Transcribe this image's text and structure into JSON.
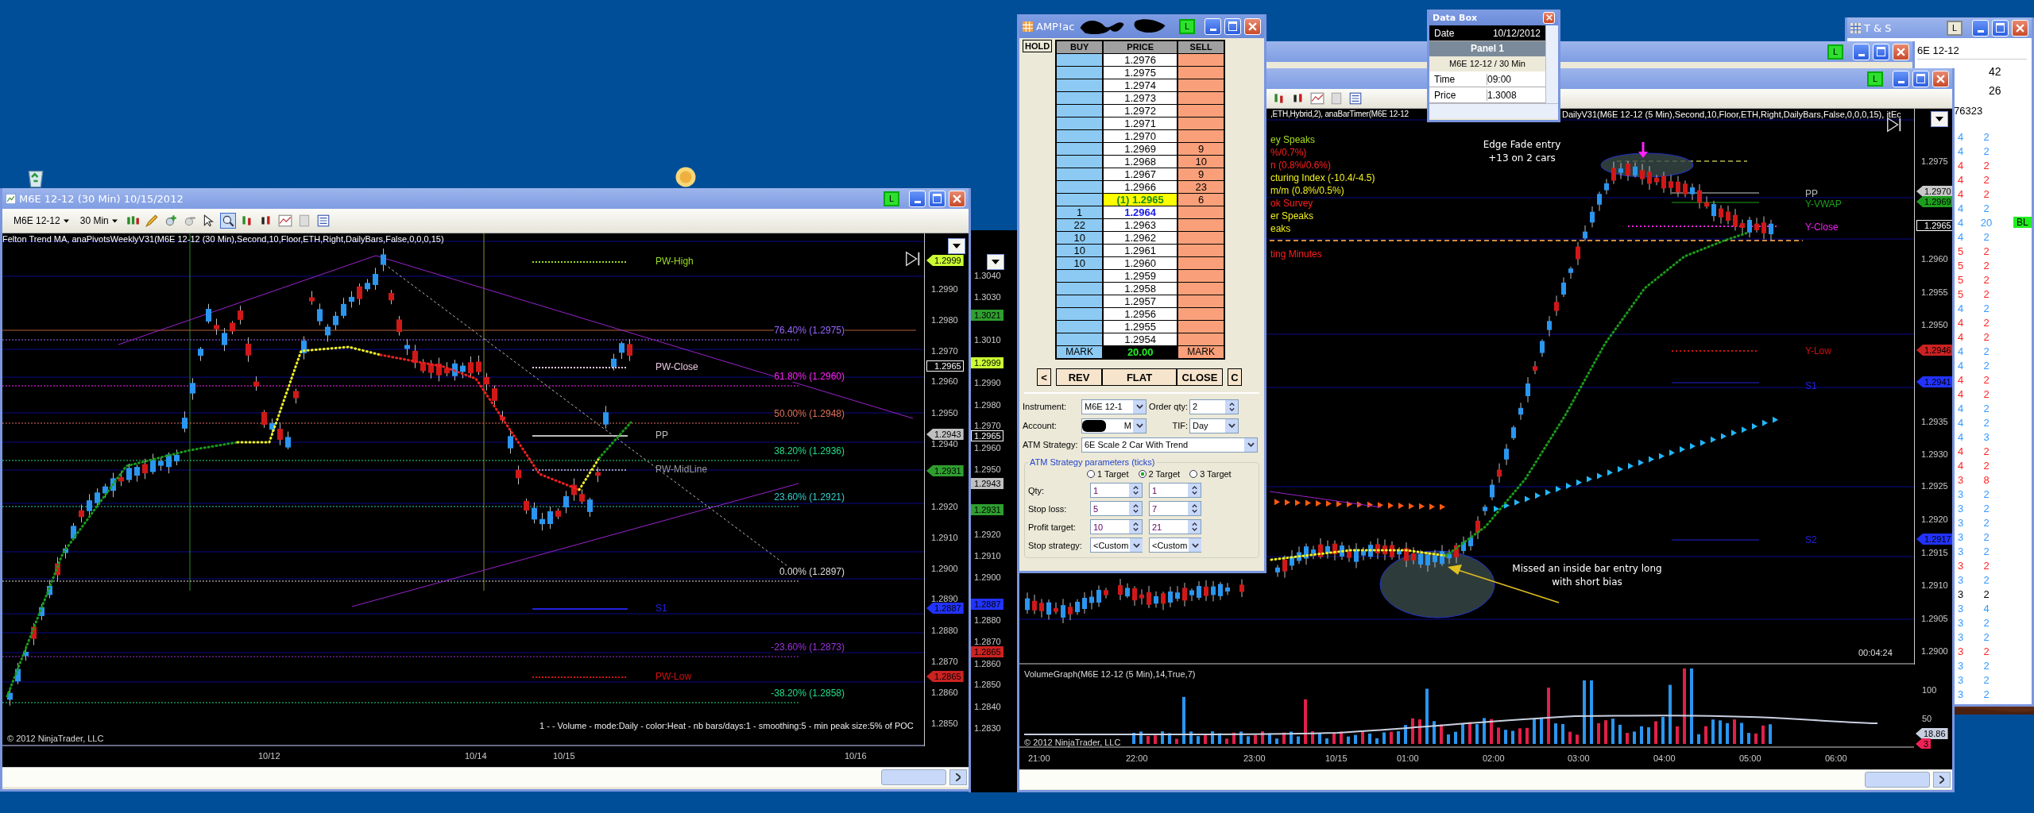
{
  "left_chart": {
    "title": "M6E 12-12 (30 Min)  10/15/2012",
    "online": "L",
    "instrument": "M6E 12-12",
    "interval": "30 Min",
    "indicators": "Felton Trend MA, anaPivotsWeeklyV31(M6E 12-12 (30 Min),Second,10,Floor,ETH,Right,DailyBars,False,0,0,0,15)",
    "price_labels": [
      "1.2990",
      "1.2980",
      "1.2970",
      "1.2960",
      "1.2950",
      "1.2940",
      "1.2920",
      "1.2910",
      "1.2900",
      "1.2890",
      "1.2880",
      "1.2870",
      "1.2860",
      "1.2850"
    ],
    "price_tags": [
      {
        "text": "1.2999",
        "color": "#ccff33"
      },
      {
        "text": "1.2965",
        "color": "#000000"
      },
      {
        "text": "1.2943",
        "color": "#c0c0c0"
      },
      {
        "text": "1.2931",
        "color": "#2f9e2f"
      },
      {
        "text": "1.2887",
        "color": "#2233ff"
      },
      {
        "text": "1.2865",
        "color": "#cc2222"
      }
    ],
    "levels": [
      {
        "label": "PW-High",
        "color": "#99dd22"
      },
      {
        "label": "PW-Close",
        "color": "#e8c8e0"
      },
      {
        "label": "PP",
        "color": "#bbbbbb"
      },
      {
        "label": "PW-MidLine",
        "color": "#9a9a9a"
      },
      {
        "label": "S1",
        "color": "#2222dd"
      },
      {
        "label": "PW-Low",
        "color": "#cc1111"
      }
    ],
    "fib_labels": [
      {
        "text": "76.40% (1.2975)",
        "color": "#9966ff"
      },
      {
        "text": "61.80% (1.2960)",
        "color": "#ff22ff"
      },
      {
        "text": "50.00% (1.2948)",
        "color": "#e0705a"
      },
      {
        "text": "38.20% (1.2936)",
        "color": "#22dd88"
      },
      {
        "text": "23.60% (1.2921)",
        "color": "#33cccc"
      },
      {
        "text": "0.00% (1.2897)",
        "color": "#dddddd"
      },
      {
        "text": "-23.60% (1.2873)",
        "color": "#9933dd"
      },
      {
        "text": "-38.20% (1.2858)",
        "color": "#22dd88"
      }
    ],
    "footer": "1 -   - Volume - mode:Daily  - color:Heat - nb bars/days:1 - smoothing:5 - min peak size:5% of POC",
    "copyright": "© 2012 NinjaTrader, LLC",
    "time_labels": [
      "10/12",
      "10/14",
      "10/15",
      "10/16"
    ]
  },
  "background_chart": {
    "price_labels": [
      "1.3040",
      "1.3030",
      "1.3010",
      "1.2990",
      "1.2980",
      "1.2970",
      "1.2960",
      "1.2950",
      "1.2920",
      "1.2910",
      "1.2900",
      "1.2880",
      "1.2870",
      "1.2860",
      "1.2850",
      "1.2840",
      "1.2830"
    ],
    "price_tags": [
      {
        "text": "1.3021",
        "color": "#2f9e2f"
      },
      {
        "text": "1.2999",
        "color": "#ccff33"
      },
      {
        "text": "1.2965",
        "color": "#000000"
      },
      {
        "text": "1.2943",
        "color": "#c0c0c0"
      },
      {
        "text": "1.2931",
        "color": "#2f9e2f"
      },
      {
        "text": "1.2887",
        "color": "#2233ff"
      },
      {
        "text": "1.2865",
        "color": "#cc2222"
      }
    ]
  },
  "dom": {
    "title": "AMP!ac",
    "online": "L",
    "hold": "HOLD",
    "headers": [
      "BUY",
      "PRICE",
      "SELL"
    ],
    "rows": [
      {
        "buy": "",
        "price": "1.2976",
        "sell": "",
        "kind": "normal"
      },
      {
        "buy": "",
        "price": "1.2975",
        "sell": "",
        "kind": "normal"
      },
      {
        "buy": "",
        "price": "1.2974",
        "sell": "",
        "kind": "normal"
      },
      {
        "buy": "",
        "price": "1.2973",
        "sell": "",
        "kind": "normal"
      },
      {
        "buy": "",
        "price": "1.2972",
        "sell": "",
        "kind": "normal"
      },
      {
        "buy": "",
        "price": "1.2971",
        "sell": "",
        "kind": "normal"
      },
      {
        "buy": "",
        "price": "1.2970",
        "sell": "",
        "kind": "normal"
      },
      {
        "buy": "",
        "price": "1.2969",
        "sell": "9",
        "kind": "normal"
      },
      {
        "buy": "",
        "price": "1.2968",
        "sell": "10",
        "kind": "normal"
      },
      {
        "buy": "",
        "price": "1.2967",
        "sell": "9",
        "kind": "normal"
      },
      {
        "buy": "",
        "price": "1.2966",
        "sell": "23",
        "kind": "normal"
      },
      {
        "buy": "",
        "price": "(1)  1.2965",
        "sell": "6",
        "kind": "last"
      },
      {
        "buy": "1",
        "price": "1.2964",
        "sell": "",
        "kind": "bid"
      },
      {
        "buy": "22",
        "price": "1.2963",
        "sell": "",
        "kind": "normal"
      },
      {
        "buy": "10",
        "price": "1.2962",
        "sell": "",
        "kind": "normal"
      },
      {
        "buy": "10",
        "price": "1.2961",
        "sell": "",
        "kind": "normal"
      },
      {
        "buy": "10",
        "price": "1.2960",
        "sell": "",
        "kind": "normal"
      },
      {
        "buy": "",
        "price": "1.2959",
        "sell": "",
        "kind": "normal"
      },
      {
        "buy": "",
        "price": "1.2958",
        "sell": "",
        "kind": "normal"
      },
      {
        "buy": "",
        "price": "1.2957",
        "sell": "",
        "kind": "normal"
      },
      {
        "buy": "",
        "price": "1.2956",
        "sell": "",
        "kind": "normal"
      },
      {
        "buy": "",
        "price": "1.2955",
        "sell": "",
        "kind": "normal"
      },
      {
        "buy": "",
        "price": "1.2954",
        "sell": "",
        "kind": "normal"
      }
    ],
    "footer": [
      "MARK",
      "20.00",
      "MARK"
    ],
    "buttons": [
      "<",
      "REV",
      "FLAT",
      "CLOSE",
      "C"
    ],
    "form": {
      "instrument_label": "Instrument:",
      "instrument": "M6E 12-1",
      "order_qty_label": "Order qty:",
      "order_qty": "2",
      "account_label": "Account:",
      "account": "M",
      "tif_label": "TIF:",
      "tif": "Day",
      "atm_label": "ATM Strategy:",
      "atm": "6E Scale 2 Car With Trend",
      "group_title": "ATM Strategy parameters (ticks)",
      "targets": [
        {
          "label": "1 Target",
          "selected": false
        },
        {
          "label": "2 Target",
          "selected": true
        },
        {
          "label": "3 Target",
          "selected": false
        }
      ],
      "params": [
        {
          "label": "Qty:",
          "kind": "spin",
          "values": [
            "1",
            "1"
          ]
        },
        {
          "label": "Stop loss:",
          "kind": "spin",
          "values": [
            "5",
            "7"
          ]
        },
        {
          "label": "Profit target:",
          "kind": "spin",
          "values": [
            "10",
            "21"
          ]
        },
        {
          "label": "Stop strategy:",
          "kind": "combo",
          "values": [
            "<Custom",
            "<Custom"
          ]
        }
      ]
    }
  },
  "data_box": {
    "title": "Data Box",
    "rows": [
      {
        "label": "Date",
        "value": "10/12/2012",
        "kind": "header"
      },
      {
        "label": "Panel 1",
        "kind": "panel"
      },
      {
        "label": "M6E 12-12 / 30 Min",
        "kind": "series"
      },
      {
        "label": "Time",
        "value": "09:00",
        "kind": "field"
      },
      {
        "label": "Price",
        "value": "1.3008",
        "kind": "field"
      }
    ]
  },
  "right_chart": {
    "online": "L",
    "back_online": "L",
    "indicators": [
      ",ETH,Hybrid,2), anaBarTimer(M6E 12-12",
      "DailyV31(M6E 12-12 (5 Min),Second,10,Floor,ETH,Right,DailyBars,False,0,0,0,15), itEc"
    ],
    "news": [
      {
        "text": "ey Speaks",
        "color": "#aadd22"
      },
      {
        "text": "%/0.7%)",
        "color": "#ff2020"
      },
      {
        "text": "n (0.8%/0.6%)",
        "color": "#ff2020"
      },
      {
        "text": "cturing Index (-10.4/-4.5)",
        "color": "#f0f020"
      },
      {
        "text": "m/m (0.8%/0.5%)",
        "color": "#f0f020"
      },
      {
        "text": "ok Survey",
        "color": "#ff2020"
      },
      {
        "text": "er Speaks",
        "color": "#f0f020"
      },
      {
        "text": "eaks",
        "color": "#f0f020"
      },
      {
        "text": "ting Minutes",
        "color": "#ff2020"
      }
    ],
    "annotations": [
      {
        "lines": [
          "Edge Fade entry",
          "+13 on 2 cars"
        ]
      },
      {
        "lines": [
          "Missed an inside bar entry long",
          "with short bias"
        ]
      }
    ],
    "price_labels": [
      "1.2975",
      "1.2960",
      "1.2955",
      "1.2950",
      "1.2935",
      "1.2930",
      "1.2925",
      "1.2920",
      "1.2915",
      "1.2910",
      "1.2905",
      "1.2900"
    ],
    "price_tags": [
      {
        "text": "1.2970",
        "color": "#c8c8c8"
      },
      {
        "text": "1.2969",
        "color": "#1e9e1e"
      },
      {
        "text": "1.2965",
        "color": "#000000"
      },
      {
        "text": "1.2946",
        "color": "#cc2222"
      },
      {
        "text": "1.2941",
        "color": "#2233ff"
      },
      {
        "text": "1.2917",
        "color": "#2233ff"
      }
    ],
    "levels": [
      {
        "label": "PP",
        "color": "#bbbbbb"
      },
      {
        "label": "Y-VWAP",
        "color": "#1e9e1e"
      },
      {
        "label": "Y-Close",
        "color": "#ee22ee"
      },
      {
        "label": "Y-Low",
        "color": "#cc1111"
      },
      {
        "label": "S1",
        "color": "#2222dd"
      },
      {
        "label": "S2",
        "color": "#2222dd"
      }
    ],
    "timer": "00:04:24",
    "volume_title": "VolumeGraph(M6E 12-12 (5 Min),14,True,7)",
    "volume_labels": [
      "100",
      "50"
    ],
    "volume_tags": [
      {
        "text": "18.86",
        "color": "#c8d0e0"
      },
      {
        "text": "3",
        "color": "#ee2255"
      }
    ],
    "copyright": "© 2012 NinjaTrader, LLC",
    "time_labels": [
      "21:00",
      "22:00",
      "23:00",
      "10/15",
      "01:00",
      "02:00",
      "03:00",
      "04:00",
      "05:00",
      "06:00"
    ]
  },
  "time_sales": {
    "title": "T & S",
    "online": "L",
    "instrument": "6E 12-12",
    "summary": [
      "42",
      "26",
      "76323"
    ],
    "trades": [
      {
        "price": "4",
        "size": "2",
        "color": "#3399ff"
      },
      {
        "price": "4",
        "size": "2",
        "color": "#3399ff"
      },
      {
        "price": "4",
        "size": "2",
        "color": "#ff2222"
      },
      {
        "price": "4",
        "size": "2",
        "color": "#ff2222"
      },
      {
        "price": "4",
        "size": "2",
        "color": "#ff2222"
      },
      {
        "price": "4",
        "size": "2",
        "color": "#3399ff"
      },
      {
        "price": "4",
        "size": "20",
        "color": "#3399ff",
        "badge": "BL"
      },
      {
        "price": "4",
        "size": "2",
        "color": "#3399ff"
      },
      {
        "price": "5",
        "size": "2",
        "color": "#ff2222"
      },
      {
        "price": "5",
        "size": "2",
        "color": "#ff2222"
      },
      {
        "price": "5",
        "size": "2",
        "color": "#ff2222"
      },
      {
        "price": "5",
        "size": "2",
        "color": "#ff2222"
      },
      {
        "price": "4",
        "size": "2",
        "color": "#3399ff"
      },
      {
        "price": "4",
        "size": "2",
        "color": "#ff2222"
      },
      {
        "price": "4",
        "size": "2",
        "color": "#ff2222"
      },
      {
        "price": "4",
        "size": "2",
        "color": "#3399ff"
      },
      {
        "price": "4",
        "size": "2",
        "color": "#3399ff"
      },
      {
        "price": "4",
        "size": "2",
        "color": "#ff2222"
      },
      {
        "price": "4",
        "size": "2",
        "color": "#ff2222"
      },
      {
        "price": "4",
        "size": "2",
        "color": "#3399ff"
      },
      {
        "price": "4",
        "size": "2",
        "color": "#3399ff"
      },
      {
        "price": "4",
        "size": "3",
        "color": "#3399ff"
      },
      {
        "price": "4",
        "size": "2",
        "color": "#ff2222"
      },
      {
        "price": "4",
        "size": "2",
        "color": "#ff2222"
      },
      {
        "price": "3",
        "size": "8",
        "color": "#ff2222"
      },
      {
        "price": "3",
        "size": "2",
        "color": "#3399ff"
      },
      {
        "price": "3",
        "size": "2",
        "color": "#3399ff"
      },
      {
        "price": "3",
        "size": "2",
        "color": "#3399ff"
      },
      {
        "price": "3",
        "size": "2",
        "color": "#3399ff"
      },
      {
        "price": "3",
        "size": "2",
        "color": "#3399ff"
      },
      {
        "price": "3",
        "size": "2",
        "color": "#ff2222"
      },
      {
        "price": "3",
        "size": "2",
        "color": "#3399ff"
      },
      {
        "price": "3",
        "size": "2",
        "color": "#000000"
      },
      {
        "price": "3",
        "size": "4",
        "color": "#3399ff"
      },
      {
        "price": "3",
        "size": "2",
        "color": "#3399ff"
      },
      {
        "price": "3",
        "size": "2",
        "color": "#3399ff"
      },
      {
        "price": "3",
        "size": "2",
        "color": "#ff2222"
      },
      {
        "price": "3",
        "size": "2",
        "color": "#3399ff"
      },
      {
        "price": "3",
        "size": "2",
        "color": "#3399ff"
      },
      {
        "price": "3",
        "size": "2",
        "color": "#3399ff"
      }
    ]
  }
}
